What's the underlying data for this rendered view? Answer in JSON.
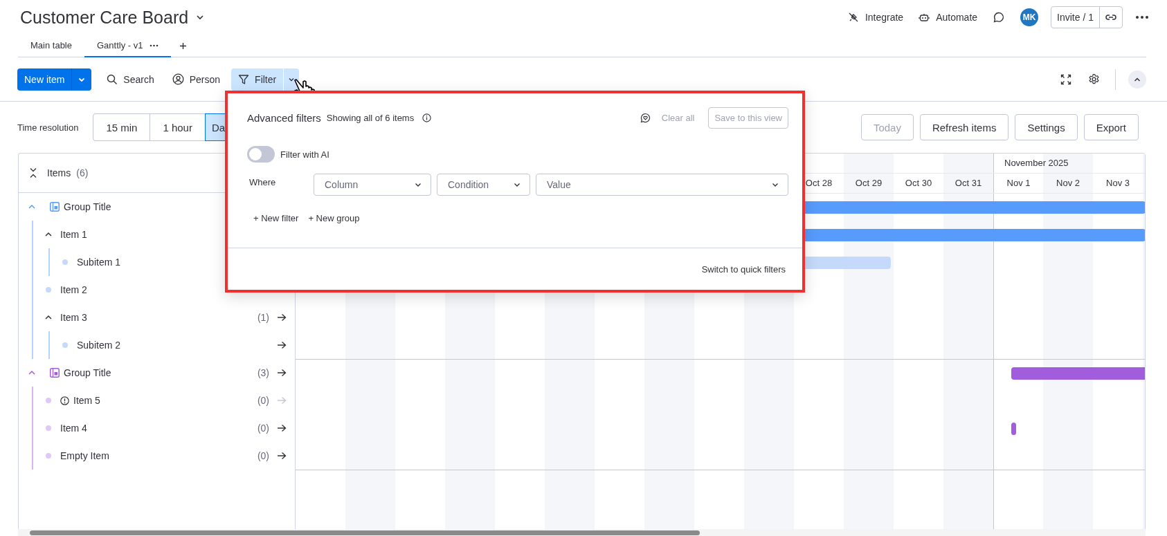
{
  "board": {
    "title": "Customer Care Board"
  },
  "header_actions": [
    {
      "kind": "integrate",
      "label": "Integrate"
    },
    {
      "kind": "automate",
      "label": "Automate"
    }
  ],
  "avatar": {
    "initials": "MK"
  },
  "invite": {
    "label": "Invite / 1"
  },
  "tabs": [
    {
      "label": "Main table",
      "selected": false
    },
    {
      "label": "Ganttly - v1",
      "selected": true
    }
  ],
  "toolbar": {
    "new_item": "New item",
    "tools": [
      {
        "kind": "search",
        "label": "Search",
        "selected": false
      },
      {
        "kind": "person",
        "label": "Person",
        "selected": false
      },
      {
        "kind": "filter",
        "label": "Filter",
        "selected": true
      }
    ]
  },
  "time_resolution": {
    "label": "Time resolution",
    "options": [
      {
        "label": "15 min",
        "selected": false
      },
      {
        "label": "1 hour",
        "selected": false
      },
      {
        "label": "Da",
        "selected": true
      }
    ]
  },
  "actions": [
    {
      "label": "Today",
      "disabled": true
    },
    {
      "label": "Refresh items",
      "disabled": false
    },
    {
      "label": "Settings",
      "disabled": false
    },
    {
      "label": "Export",
      "disabled": false
    }
  ],
  "items_header": {
    "label": "Items",
    "count": "(6)"
  },
  "groups": [
    {
      "title": "Group Title",
      "color": "#579bfc",
      "expanded": true,
      "bar": {
        "kind": "full",
        "color": "#579bfc"
      },
      "children": [
        {
          "label": "Item 1",
          "expanded": true,
          "warning": false,
          "bar": {
            "kind": "full",
            "color": "#579bfc"
          },
          "children": [
            {
              "label": "Subitem 1",
              "color": "#c5d9fa",
              "warning": false,
              "bar": {
                "kind": "fill",
                "level": 0.7,
                "color": "#c5d9fa"
              }
            }
          ]
        },
        {
          "label": "Item 2",
          "color": "#c5d9fa",
          "warning": false
        },
        {
          "label": "Item 3",
          "expanded": true,
          "warning": false,
          "count": "(1)",
          "arrow": {
            "disabled": false
          },
          "children": [
            {
              "label": "Subitem 2",
              "color": "#c5d9fa",
              "warning": false,
              "arrow": {
                "disabled": false
              }
            }
          ]
        }
      ]
    },
    {
      "title": "Group Title",
      "color": "#a25ddc",
      "expanded": true,
      "count": "(3)",
      "arrow": {
        "disabled": false
      },
      "bar": {
        "kind": "month",
        "color": "#a25ddc"
      },
      "children": [
        {
          "label": "Item 5",
          "color": "#e0c9f5",
          "warning": true,
          "count": "(0)",
          "arrow": {
            "disabled": true
          }
        },
        {
          "label": "Item 4",
          "color": "#e0c9f5",
          "warning": false,
          "count": "(0)",
          "arrow": {
            "disabled": false
          },
          "bar": {
            "kind": "point",
            "color": "#a25ddc"
          }
        },
        {
          "label": "Empty Item",
          "color": "#e0c9f5",
          "warning": false,
          "count": "(0)",
          "arrow": {
            "disabled": false
          }
        }
      ]
    }
  ],
  "timeline": {
    "month": "November 2025",
    "days": [
      {
        "label": "Oct 28",
        "month_start": false
      },
      {
        "label": "Oct 29",
        "month_start": false
      },
      {
        "label": "Oct 30",
        "month_start": false
      },
      {
        "label": "Oct 31",
        "month_start": false
      },
      {
        "label": "Nov 1",
        "month_start": true
      },
      {
        "label": "Nov 2",
        "month_start": false
      },
      {
        "label": "Nov 3",
        "month_start": false
      }
    ]
  },
  "filter_panel": {
    "title": "Advanced filters",
    "summary": "Showing all of 6 items",
    "clear": {
      "label": "Clear all",
      "disabled": true
    },
    "save": {
      "label": "Save to this view",
      "disabled": true
    },
    "ai_toggle": {
      "label": "Filter with AI",
      "on": false
    },
    "where": "Where",
    "selects": [
      {
        "kind": "column",
        "placeholder": "Column"
      },
      {
        "kind": "condition",
        "placeholder": "Condition"
      },
      {
        "kind": "value",
        "placeholder": "Value"
      }
    ],
    "add_links": [
      "+ New filter",
      "+ New group"
    ],
    "switch": "Switch to quick filters"
  }
}
